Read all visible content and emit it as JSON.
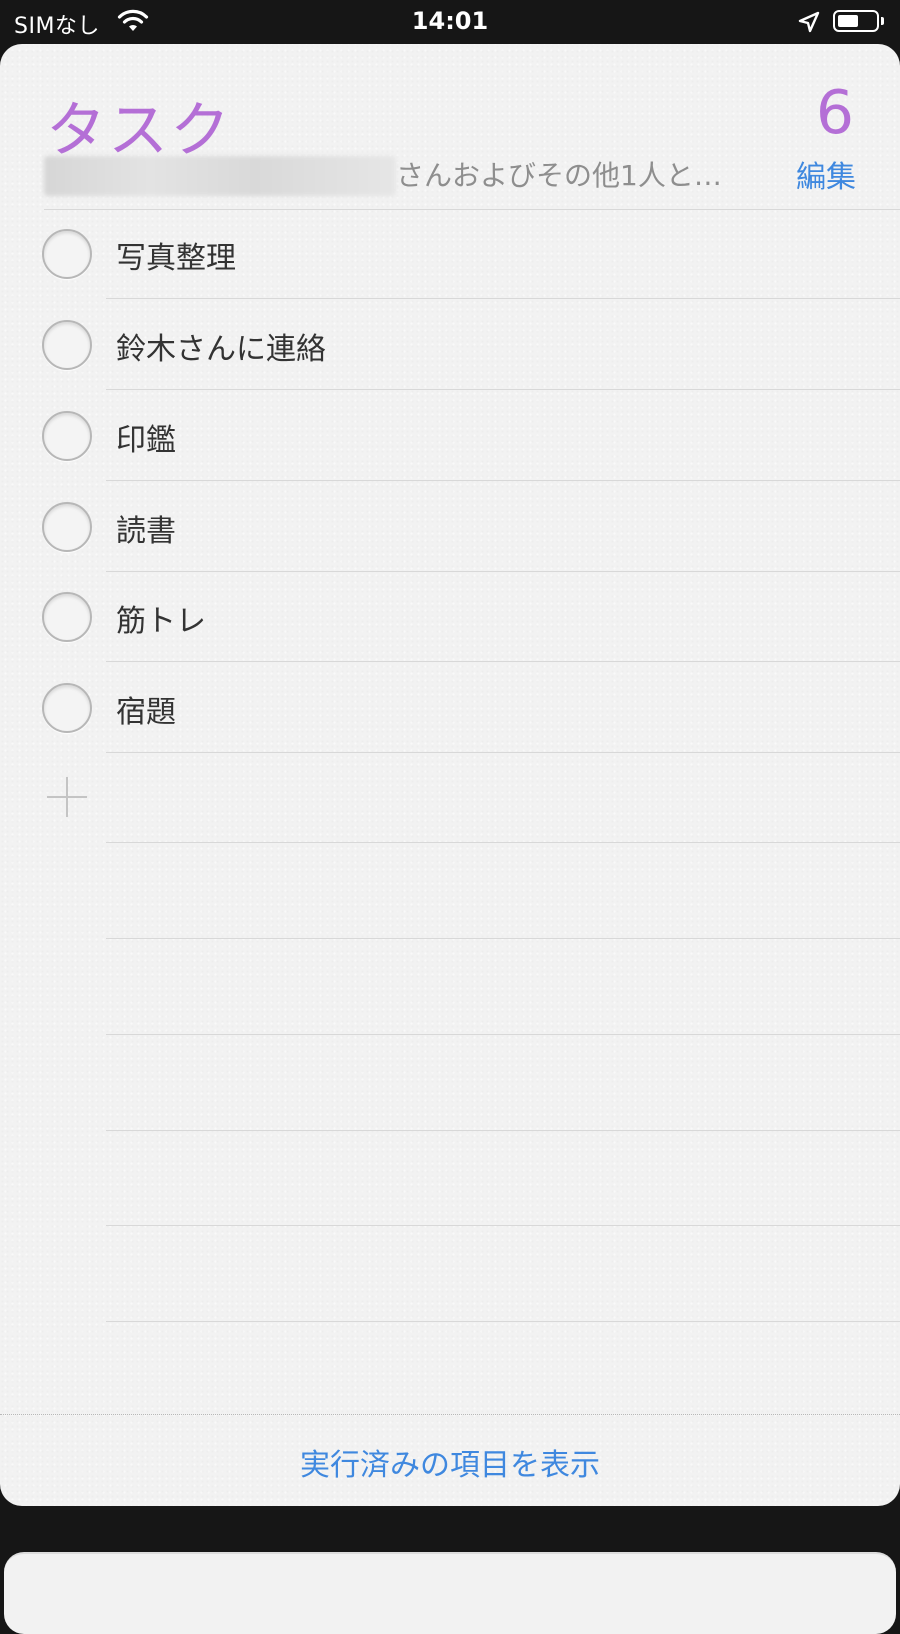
{
  "status_bar": {
    "carrier": "SIMなし",
    "time": "14:01",
    "battery_level": 0.55
  },
  "list": {
    "title": "タスク",
    "count": "6",
    "shared_with_text": "さんおよびその他1人と…",
    "edit_label": "編集",
    "accent_color": "#b46fd6",
    "link_color": "#3f88df",
    "items": [
      {
        "label": "写真整理"
      },
      {
        "label": "鈴木さんに連絡"
      },
      {
        "label": "印鑑"
      },
      {
        "label": "読書"
      },
      {
        "label": "筋トレ"
      },
      {
        "label": "宿題"
      }
    ],
    "show_completed_label": "実行済みの項目を表示"
  }
}
